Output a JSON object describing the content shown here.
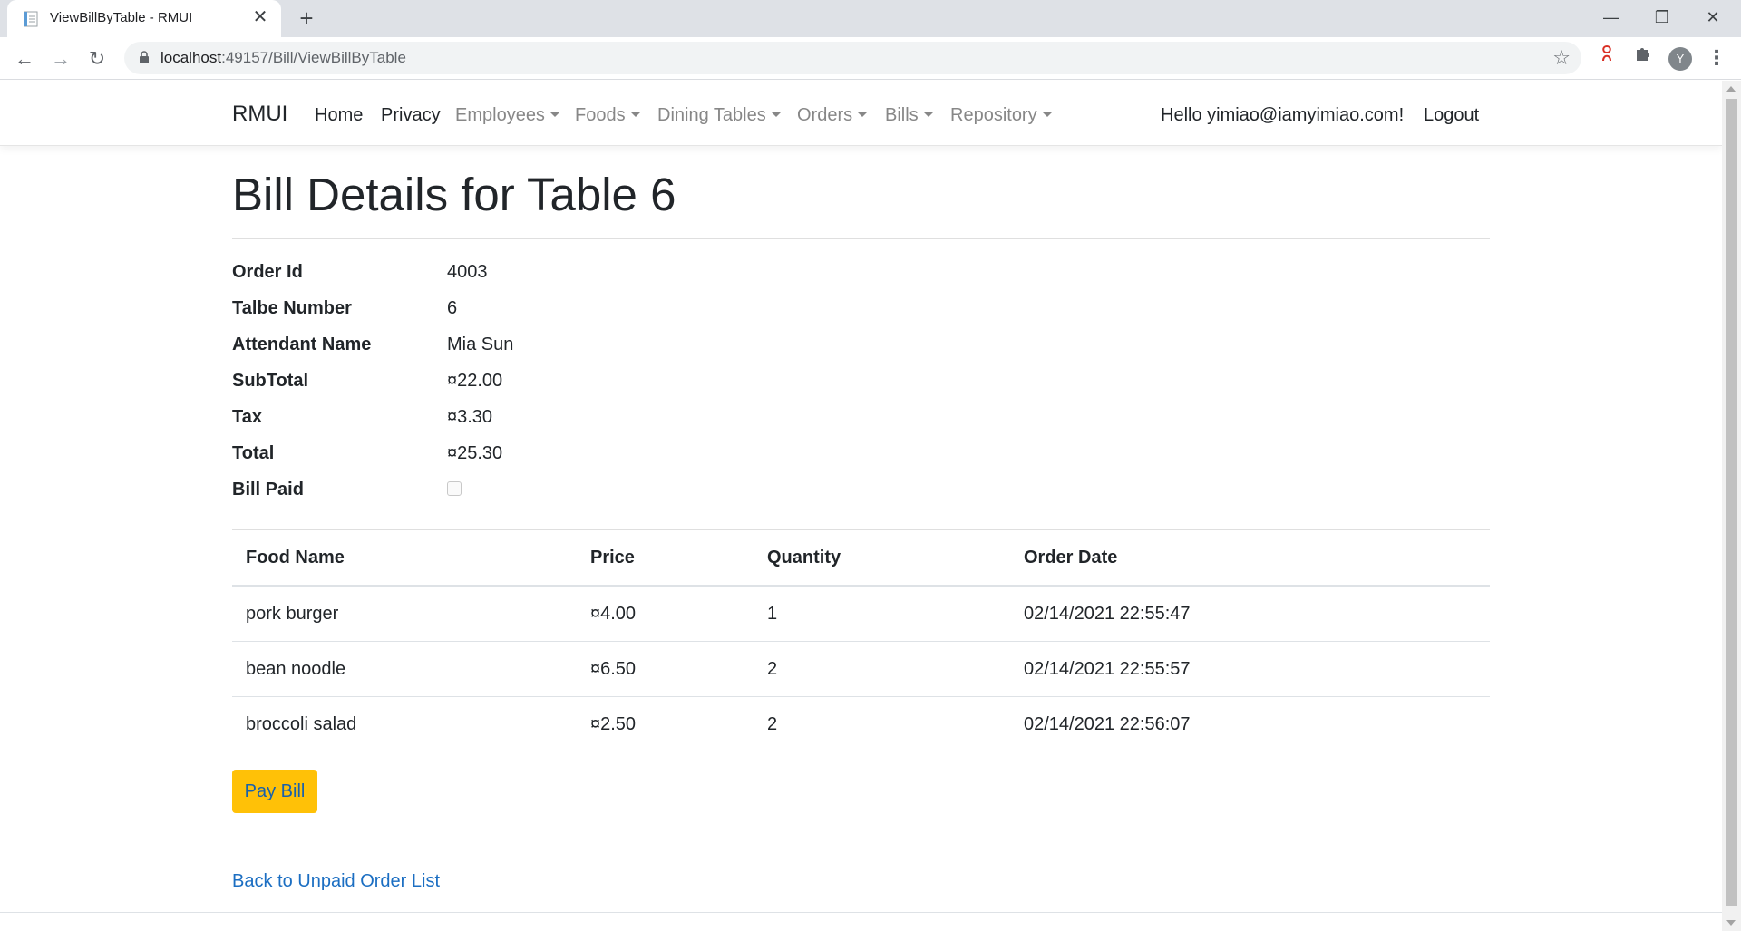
{
  "browser": {
    "tab_title": "ViewBillByTable - RMUI",
    "url_host": "localhost",
    "url_path": ":49157/Bill/ViewBillByTable",
    "avatar_letter": "Y"
  },
  "navbar": {
    "brand": "RMUI",
    "items": [
      {
        "label": "Home",
        "dropdown": false
      },
      {
        "label": "Privacy",
        "dropdown": false
      },
      {
        "label": "Employees",
        "dropdown": true
      },
      {
        "label": "Foods",
        "dropdown": true
      },
      {
        "label": "Dining Tables",
        "dropdown": true
      },
      {
        "label": "Orders",
        "dropdown": true
      },
      {
        "label": "Bills",
        "dropdown": true
      },
      {
        "label": "Repository",
        "dropdown": true
      }
    ],
    "greeting": "Hello yimiao@iamyimiao.com!",
    "logout": "Logout"
  },
  "page": {
    "title": "Bill Details for Table 6",
    "details": [
      {
        "label": "Order Id",
        "value": "4003"
      },
      {
        "label": "Talbe Number",
        "value": "6"
      },
      {
        "label": "Attendant Name",
        "value": "Mia Sun"
      },
      {
        "label": "SubTotal",
        "value": "¤22.00"
      },
      {
        "label": "Tax",
        "value": "¤3.30"
      },
      {
        "label": "Total",
        "value": "¤25.30"
      },
      {
        "label": "Bill Paid",
        "value": ""
      }
    ],
    "bill_paid": false,
    "table": {
      "headers": [
        "Food Name",
        "Price",
        "Quantity",
        "Order Date"
      ],
      "rows": [
        [
          "pork burger",
          "¤4.00",
          "1",
          "02/14/2021 22:55:47"
        ],
        [
          "bean noodle",
          "¤6.50",
          "2",
          "02/14/2021 22:55:57"
        ],
        [
          "broccoli salad",
          "¤2.50",
          "2",
          "02/14/2021 22:56:07"
        ]
      ]
    },
    "pay_button": "Pay Bill",
    "back_link": "Back to Unpaid Order List"
  },
  "colors": {
    "pay_button_bg": "#ffc107",
    "link": "#1b6ec2",
    "nav_muted": "#878787"
  }
}
